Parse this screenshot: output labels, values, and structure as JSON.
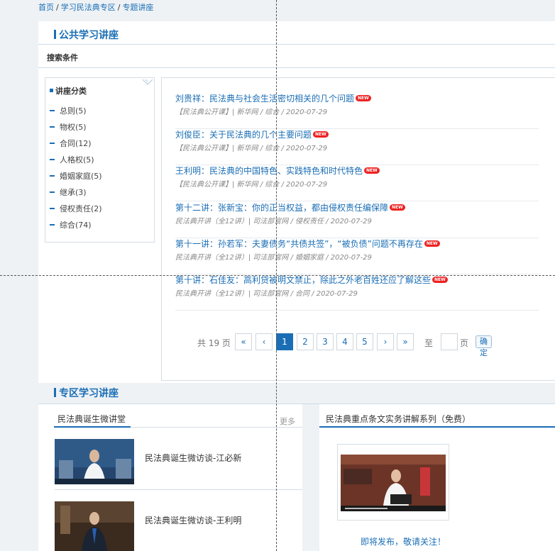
{
  "breadcrumb": {
    "home": "首页",
    "zone": "学习民法典专区",
    "current": "专题讲座"
  },
  "public_section": {
    "title": "公共学习讲座",
    "search_label": "搜索条件"
  },
  "categories": {
    "heading": "讲座分类",
    "items": [
      {
        "label": "总则(5)"
      },
      {
        "label": "物权(5)"
      },
      {
        "label": "合同(12)"
      },
      {
        "label": "人格权(5)"
      },
      {
        "label": "婚姻家庭(5)"
      },
      {
        "label": "继承(3)"
      },
      {
        "label": "侵权责任(2)"
      },
      {
        "label": "综合(74)"
      }
    ]
  },
  "lectures": [
    {
      "title": "刘贵祥：民法典与社会生活密切相关的几个问题",
      "badge": "NEW",
      "meta": "【民法典公开课】| 新华网 / 综合 / 2020-07-29"
    },
    {
      "title": "刘俊臣：关于民法典的几个主要问题",
      "badge": "NEW",
      "meta": "【民法典公开课】| 新华网 / 综合 / 2020-07-29"
    },
    {
      "title": "王利明：民法典的中国特色、实践特色和时代特色",
      "badge": "NEW",
      "meta": "【民法典公开课】| 新华网 / 综合 / 2020-07-29"
    },
    {
      "title": "第十二讲：张新宝：你的正当权益，都由侵权责任编保障",
      "badge": "NEW",
      "meta": "民法典开讲（全12讲）| 司法部官网 / 侵权责任 / 2020-07-29"
    },
    {
      "title": "第十一讲：孙若军：夫妻债务“共债共签”，“被负债”问题不再存在",
      "badge": "NEW",
      "meta": "民法典开讲（全12讲）| 司法部官网 / 婚姻家庭 / 2020-07-29"
    },
    {
      "title": "第十讲：石佳友：高利贷被明文禁止，除此之外老百姓还应了解这些",
      "badge": "NEW",
      "meta": "民法典开讲（全12讲）| 司法部官网 / 合同 / 2020-07-29"
    }
  ],
  "pager": {
    "total": "共 19 页",
    "first": "«",
    "prev": "‹",
    "pages": [
      "1",
      "2",
      "3",
      "4",
      "5"
    ],
    "next": "›",
    "last": "»",
    "goto_prefix": "至",
    "goto_suffix": "页",
    "confirm": "确定",
    "current_page": 1
  },
  "zone_section": {
    "title": "专区学习讲座",
    "tab_left": "民法典诞生微讲堂",
    "more": "更多",
    "tab_right": "民法典重点条文实务讲解系列（免费）",
    "videos": [
      {
        "title": "民法典诞生微访谈-江必新"
      },
      {
        "title": "民法典诞生微访谈-王利明"
      }
    ],
    "publish_notice": "即将发布，敬请关注！"
  },
  "colors": {
    "accent": "#1a6eb5",
    "badge": "#ee2222"
  }
}
